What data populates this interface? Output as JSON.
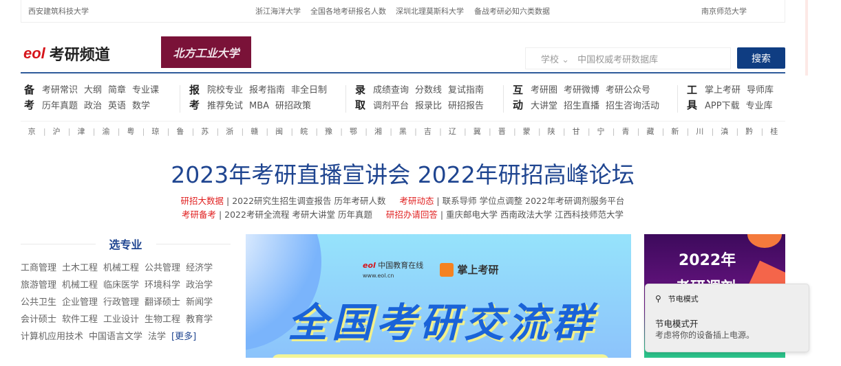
{
  "topbar": {
    "items": [
      "西安建筑科技大学",
      "浙江海洋大学",
      "全国各地考研报名人数",
      "深圳北理莫斯科大学",
      "备战考研必知六类数据",
      "南京师范大学"
    ]
  },
  "header": {
    "logo_eol": "eol",
    "logo_text": "考研频道",
    "school_logo": "北方工业大学",
    "search_scope": "学校",
    "search_placeholder": "中国权威考研数据库",
    "search_button": "搜索"
  },
  "nav": [
    {
      "head": "备考",
      "rows": [
        [
          "考研常识",
          "大纲",
          "简章",
          "专业课"
        ],
        [
          "历年真题",
          "政治",
          "英语",
          "数学"
        ]
      ]
    },
    {
      "head": "报考",
      "rows": [
        [
          "院校专业",
          "报考指南",
          "非全日制"
        ],
        [
          "推荐免试",
          "MBA",
          "研招政策"
        ]
      ]
    },
    {
      "head": "录取",
      "rows": [
        [
          "成绩查询",
          "分数线",
          "复试指南"
        ],
        [
          "调剂平台",
          "报录比",
          "研招报告"
        ]
      ]
    },
    {
      "head": "互动",
      "rows": [
        [
          "考研圈",
          "考研微博",
          "考研公众号"
        ],
        [
          "大讲堂",
          "招生直播",
          "招生咨询活动"
        ]
      ]
    },
    {
      "head": "工具",
      "rows": [
        [
          "掌上考研",
          "导师库"
        ],
        [
          "APP下载",
          "专业库"
        ]
      ]
    }
  ],
  "provinces": [
    "京",
    "沪",
    "津",
    "渝",
    "粤",
    "琼",
    "鲁",
    "苏",
    "浙",
    "赣",
    "闽",
    "皖",
    "豫",
    "鄂",
    "湘",
    "黑",
    "吉",
    "辽",
    "冀",
    "晋",
    "蒙",
    "陕",
    "甘",
    "宁",
    "青",
    "藏",
    "新",
    "川",
    "滇",
    "黔",
    "桂"
  ],
  "headline": "2023年考研直播宣讲会 2022年研招高峰论坛",
  "links": [
    [
      {
        "label": "研招大数据",
        "items": [
          "2022研究生招生调查报告",
          "历年考研人数"
        ]
      },
      {
        "label": "考研动态",
        "items": [
          "联系导师",
          "学位点调整",
          "2022年考研调剂服务平台"
        ]
      }
    ],
    [
      {
        "label": "考研备考",
        "items": [
          "2022考研全流程",
          "考研大讲堂",
          "历年真题"
        ]
      },
      {
        "label": "研招办请回答",
        "items": [
          "重庆邮电大学",
          "西南政法大学",
          "江西科技师范大学"
        ]
      }
    ]
  ],
  "majors_section": {
    "title": "选专业",
    "items": [
      "工商管理",
      "土木工程",
      "机械工程",
      "公共管理",
      "经济学",
      "旅游管理",
      "机械工程",
      "临床医学",
      "环境科学",
      "政治学",
      "公共卫生",
      "企业管理",
      "行政管理",
      "翻译硕士",
      "新闻学",
      "会计硕士",
      "软件工程",
      "工业设计",
      "生物工程",
      "教育学",
      "计算机应用技术",
      "中国语言文学",
      "法学"
    ],
    "more": "[更多]"
  },
  "banner": {
    "eol_text": "中国教育在线",
    "eol_url": "www.eol.cn",
    "app_text": "掌上考研",
    "title": "全国考研交流群"
  },
  "right_banner": {
    "line1": "2022年",
    "line2": "考研调剂"
  },
  "toast": {
    "app": "节电模式",
    "title": "节电模式开",
    "body": "考虑将你的设备插上电源。"
  }
}
